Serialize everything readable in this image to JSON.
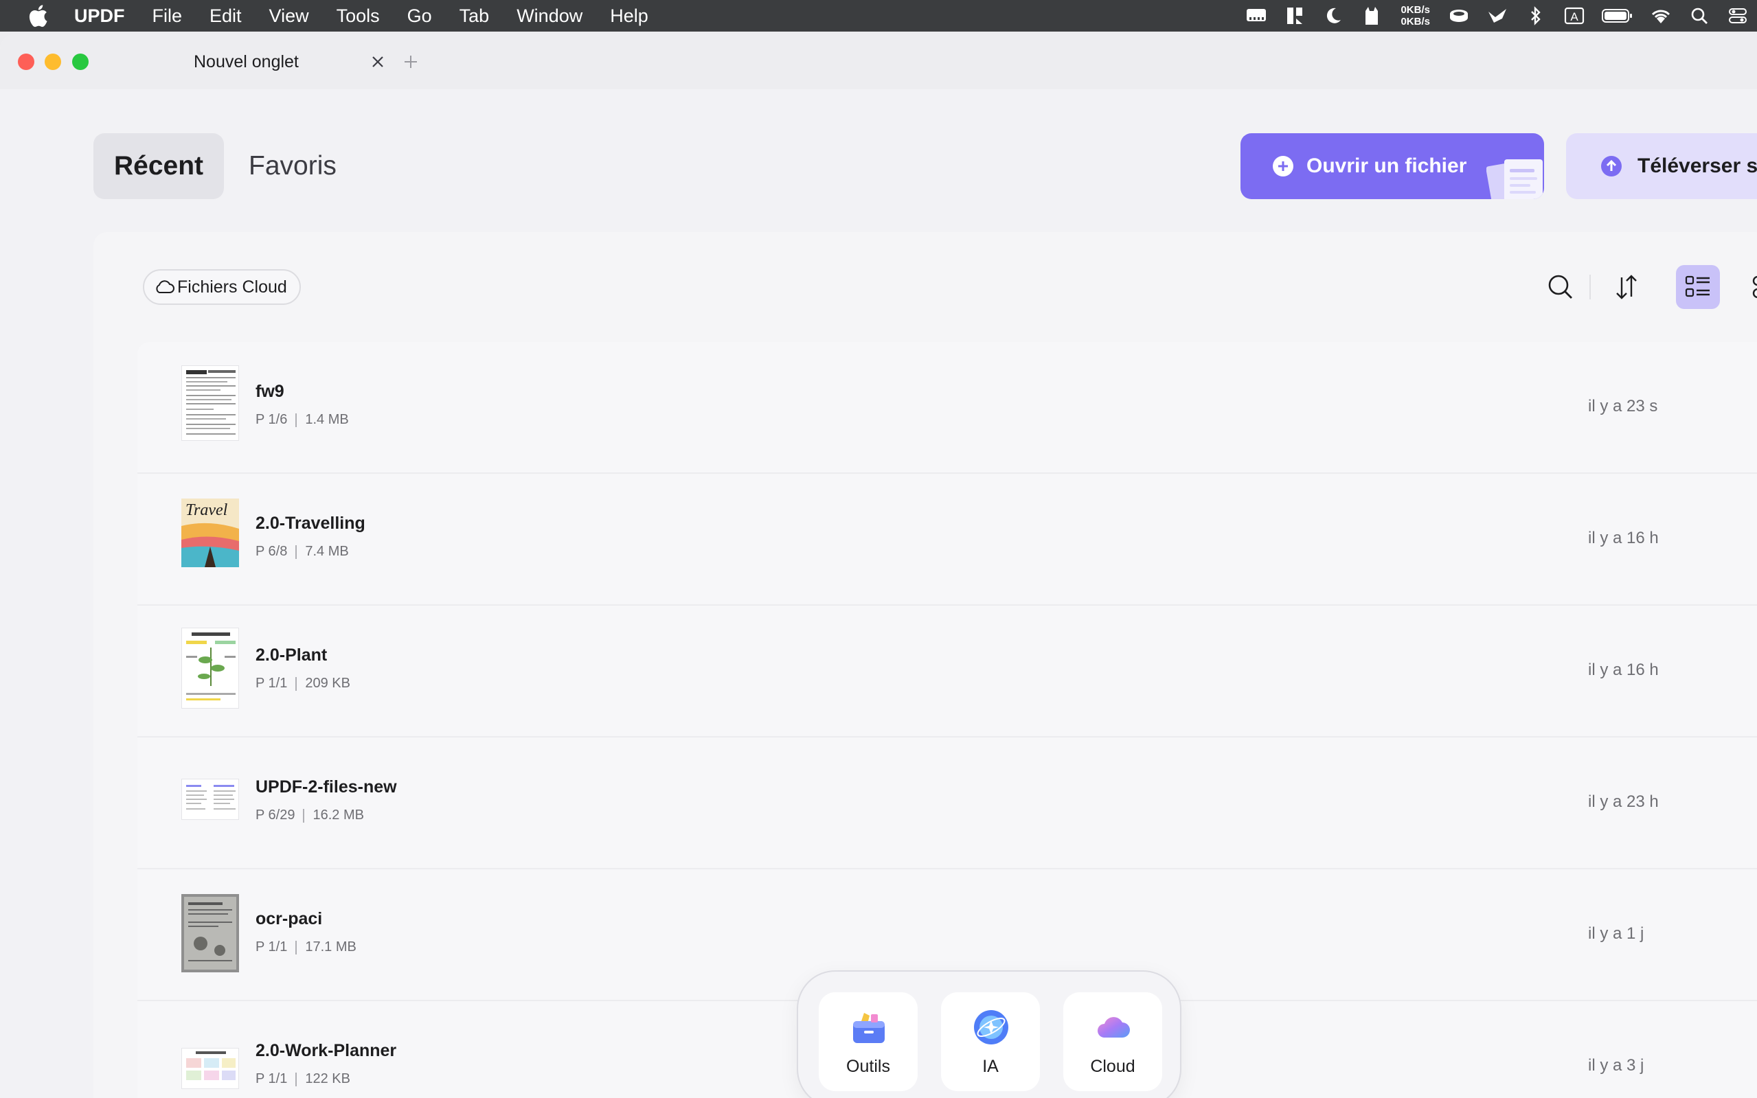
{
  "menubar": {
    "app_name": "UPDF",
    "menus": [
      "File",
      "Edit",
      "View",
      "Tools",
      "Go",
      "Tab",
      "Window",
      "Help"
    ],
    "network_up": "0KB/s",
    "network_down": "0KB/s",
    "input_source": "A",
    "status_icons": [
      "display-icon",
      "dock-icon",
      "moon-icon",
      "cat-icon",
      "network-speed",
      "disk-icon",
      "bird-icon",
      "bluetooth-icon",
      "input-source-icon",
      "battery-icon",
      "wifi-icon",
      "spotlight-icon",
      "control-center-icon"
    ]
  },
  "tab": {
    "title": "Nouvel onglet"
  },
  "segments": {
    "recent": "Récent",
    "favorites": "Favoris"
  },
  "actions": {
    "open_file": "Ouvrir un fichier",
    "upload": "Téléverser su"
  },
  "filters": {
    "cloud_files": "Fichiers Cloud"
  },
  "files": [
    {
      "name": "fw9",
      "pages": "P 1/6",
      "size": "1.4 MB",
      "time": "il y a 23 s"
    },
    {
      "name": "2.0-Travelling",
      "pages": "P 6/8",
      "size": "7.4 MB",
      "time": "il y a 16 h"
    },
    {
      "name": "2.0-Plant",
      "pages": "P 1/1",
      "size": "209 KB",
      "time": "il y a 16 h"
    },
    {
      "name": "UPDF-2-files-new",
      "pages": "P 6/29",
      "size": "16.2 MB",
      "time": "il y a 23 h"
    },
    {
      "name": "ocr-paci",
      "pages": "P 1/1",
      "size": "17.1 MB",
      "time": "il y a 1 j"
    },
    {
      "name": "2.0-Work-Planner",
      "pages": "P 1/1",
      "size": "122 KB",
      "time": "il y a 3 j"
    }
  ],
  "thumb_text": {
    "travel": "Travel"
  },
  "dock": {
    "tools": "Outils",
    "ai": "IA",
    "cloud": "Cloud"
  },
  "colors": {
    "accent": "#7c6cf2",
    "accent_light": "#e2defb",
    "menubar": "#3b3d3f"
  }
}
